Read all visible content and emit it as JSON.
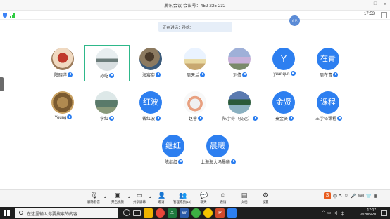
{
  "window": {
    "title": "腾讯会议 会议号：452 225 232",
    "controls": [
      "—",
      "□",
      "✕"
    ]
  },
  "infobar": {
    "time": "17:53"
  },
  "speaking": {
    "label": "正在讲话：孙屹；"
  },
  "self_view": {
    "label": "自己"
  },
  "participants": [
    {
      "name": "陆晓洋",
      "avatar": "photo",
      "style": "photo1"
    },
    {
      "name": "孙屹",
      "avatar": "photo",
      "style": "photo2",
      "active": true
    },
    {
      "name": "海宸奕",
      "avatar": "photo",
      "style": "photo3"
    },
    {
      "name": "周天兰",
      "avatar": "photo",
      "style": "photo4"
    },
    {
      "name": "刘倩",
      "avatar": "photo",
      "style": "photo5"
    },
    {
      "name": "yuanqun",
      "avatar": "text",
      "initials": "Y"
    },
    {
      "name": "周在青",
      "avatar": "text",
      "initials": "在青"
    },
    {
      "name": "Young",
      "avatar": "photo",
      "style": "photo6"
    },
    {
      "name": "李红",
      "avatar": "photo",
      "style": "photo7"
    },
    {
      "name": "钱红波",
      "avatar": "text",
      "initials": "红波"
    },
    {
      "name": "赵睿",
      "avatar": "photo",
      "style": "photo8"
    },
    {
      "name": "陈宇奇（交运）",
      "avatar": "photo",
      "style": "photo9"
    },
    {
      "name": "秦金贤",
      "avatar": "text",
      "initials": "金贤"
    },
    {
      "name": "王学铎课程",
      "avatar": "text",
      "initials": "课程"
    },
    {
      "name": "陈继红",
      "avatar": "text",
      "initials": "继红"
    },
    {
      "name": "上海海大冯晨曦",
      "avatar": "text",
      "initials": "晨曦"
    }
  ],
  "toolbar": {
    "items": [
      {
        "label": "解除静音",
        "icon": "mic-icon"
      },
      {
        "label": "开启视频",
        "icon": "camera-icon"
      },
      {
        "label": "共享屏幕",
        "icon": "share-screen-icon"
      },
      {
        "label": "邀请",
        "icon": "invite-icon"
      },
      {
        "label": "管理成员(16)",
        "icon": "members-icon"
      },
      {
        "label": "聊天",
        "icon": "chat-icon"
      },
      {
        "label": "表情",
        "icon": "emoji-icon"
      },
      {
        "label": "文档",
        "icon": "document-icon"
      },
      {
        "label": "设置",
        "icon": "settings-icon"
      }
    ]
  },
  "ime": {
    "label": "中"
  },
  "taskbar": {
    "search_placeholder": "在这里输入你要搜索的内容",
    "clock_time": "17:07",
    "clock_date": "2020/5/20"
  },
  "colors": {
    "accent_blue": "#2d7ff0",
    "active_border": "#2eb88a",
    "taskbar_bg": "#1e1e1e"
  }
}
